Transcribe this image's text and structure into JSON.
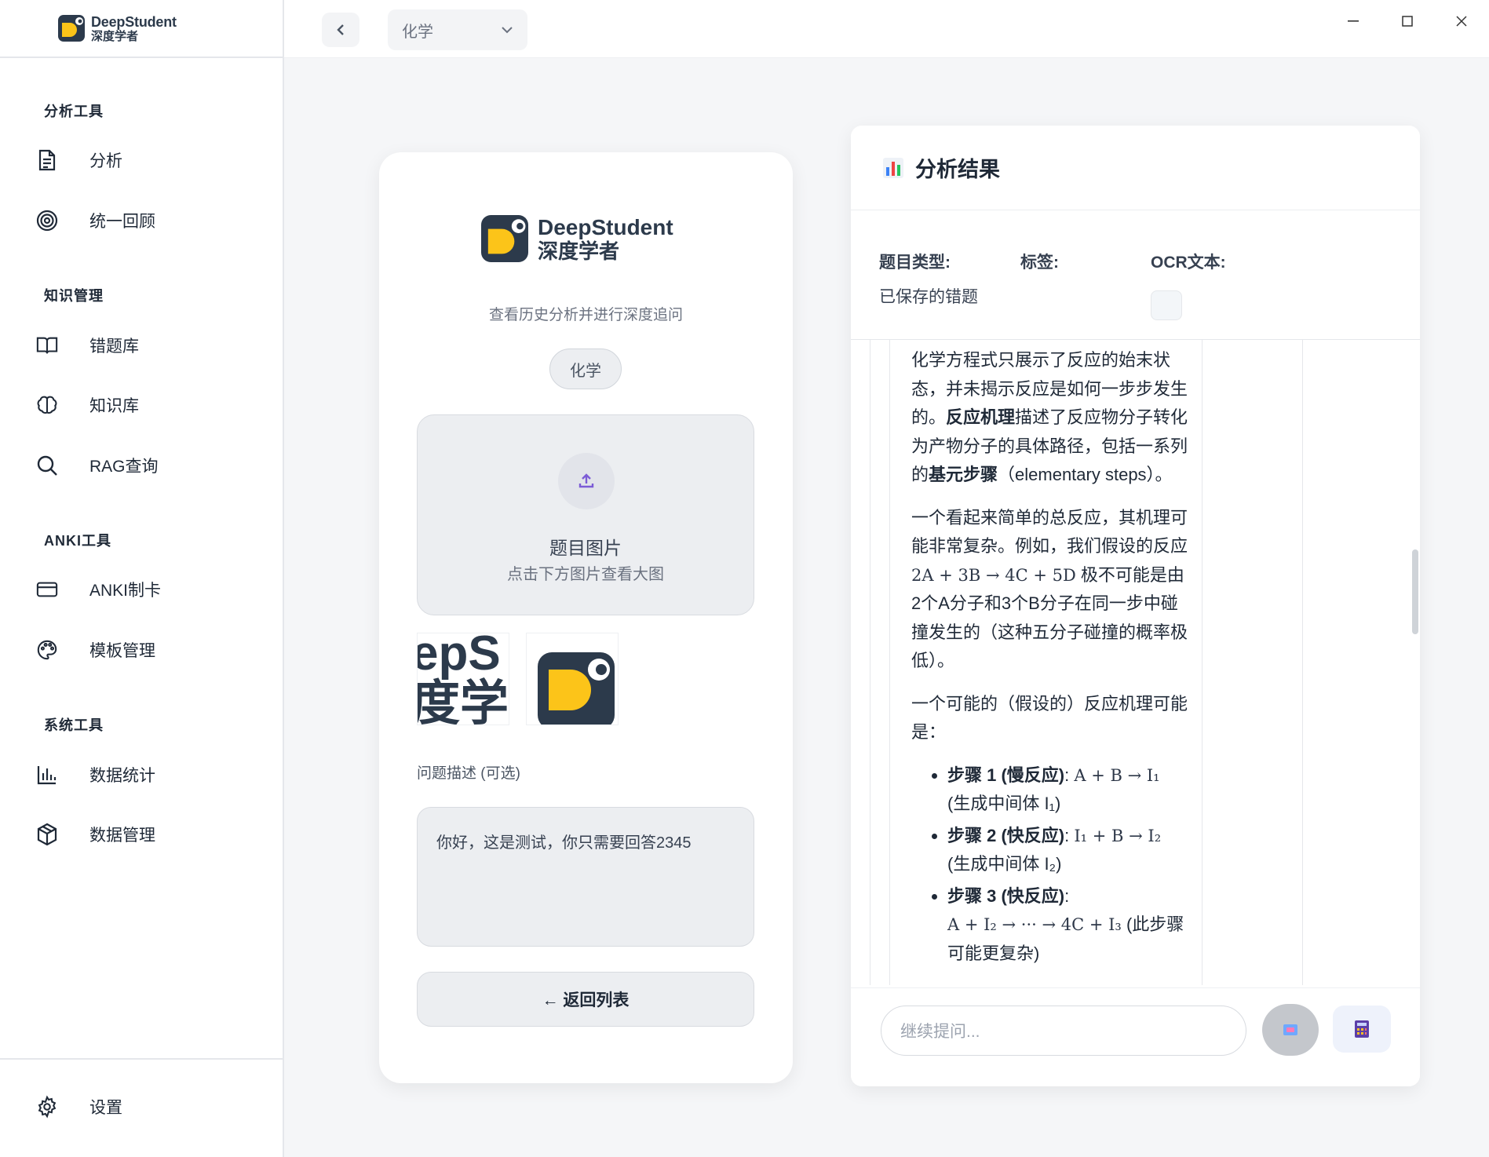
{
  "brand": {
    "name_en": "DeepStudent",
    "name_cn": "深度学者"
  },
  "sidebar": {
    "sections": [
      {
        "title": "分析工具",
        "items": [
          {
            "label": "分析",
            "icon": "document-icon"
          },
          {
            "label": "统一回顾",
            "icon": "target-icon"
          }
        ]
      },
      {
        "title": "知识管理",
        "items": [
          {
            "label": "错题库",
            "icon": "book-icon"
          },
          {
            "label": "知识库",
            "icon": "brain-icon"
          },
          {
            "label": "RAG查询",
            "icon": "search-icon"
          }
        ]
      },
      {
        "title": "ANKI工具",
        "items": [
          {
            "label": "ANKI制卡",
            "icon": "card-icon"
          },
          {
            "label": "模板管理",
            "icon": "palette-icon"
          }
        ]
      },
      {
        "title": "系统工具",
        "items": [
          {
            "label": "数据统计",
            "icon": "bar-chart-icon"
          },
          {
            "label": "数据管理",
            "icon": "package-icon"
          }
        ]
      }
    ],
    "settings_label": "设置"
  },
  "topbar": {
    "subject": "化学"
  },
  "left_card": {
    "subtitle": "查看历史分析并进行深度追问",
    "subject_chip": "化学",
    "upload_title": "题目图片",
    "upload_hint": "点击下方图片查看大图",
    "thumb1_text_line1": "epS",
    "thumb1_text_line2": "度学",
    "desc_label": "问题描述 (可选)",
    "desc_value": "你好，这是测试，你只需要回答2345",
    "back_button": "← 返回列表"
  },
  "right_card": {
    "title": "分析结果",
    "meta": {
      "type_label": "题目类型:",
      "type_value": "已保存的错题",
      "tags_label": "标签:",
      "ocr_label": "OCR文本:"
    },
    "content": {
      "p1_a": "化学方程式只展示了反应的始末状态，并未揭示反应是如何一步步发生的。",
      "p1_b": "反应机理",
      "p1_c": "描述了反应物分子转化为产物分子的具体路径，包括一系列的",
      "p1_d": "基元步骤",
      "p1_e": "（elementary steps）。",
      "p2_a": "一个看起来简单的总反应，其机理可能非常复杂。例如，我们假设的反应",
      "p2_math": "2A + 3B → 4C + 5D",
      "p2_b": "极不可能是由2个A分子和3个B分子在同一步中碰撞发生的（这种五分子碰撞的概率极低）。",
      "p3": "一个可能的（假设的）反应机理可能是：",
      "step1_label": "步骤 1 (慢反应)",
      "step1_eq": "A + B → I₁",
      "step1_note": "(生成中间体 I₁)",
      "step2_label": "步骤 2 (快反应)",
      "step2_eq": "I₁ + B → I₂",
      "step2_note": "(生成中间体 I₂)",
      "step3_label": "步骤 3 (快反应)",
      "step3_eq": "A + I₂ → ··· → 4C + I₃",
      "step3_note": "(此步骤可能更复杂)"
    },
    "ask_placeholder": "继续提问..."
  },
  "colors": {
    "brand_yellow": "#fcc419",
    "brand_dark": "#2c3a4b",
    "accent_purple": "#7c5cd6"
  }
}
